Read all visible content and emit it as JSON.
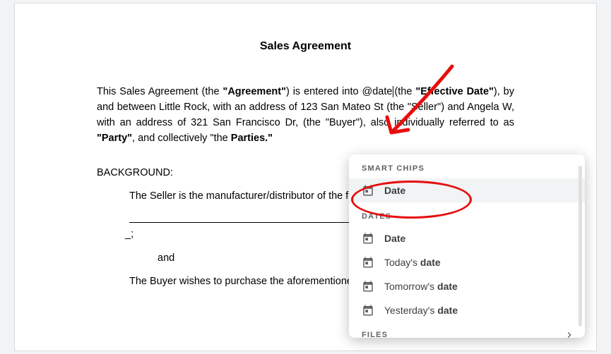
{
  "document": {
    "title": "Sales Agreement",
    "paragraph1_part1": "This Sales Agreement (the ",
    "paragraph1_bold1": "\"Agreement\"",
    "paragraph1_part2": ") is entered into ",
    "at_mention": "@date",
    "paragraph1_part3": "(the ",
    "paragraph1_bold2": "\"Effective Date\"",
    "paragraph1_part4": "), by and between Little Rock, with an address of 123 San Mateo St (the \"Seller\") and Angela W, with an address of 321 San Francisco Dr, (the \"Buyer\"), also individually referred to as ",
    "paragraph1_bold3": "\"Party\"",
    "paragraph1_part5": ", and collectively \"the ",
    "paragraph1_bold4": "Parties.\"",
    "background_heading": "BACKGROUND:",
    "bg_line1": "The Seller is the manufacturer/distributor of the following product(s):",
    "trailing_semi": "_;",
    "and_text": "and",
    "bg_line2": "The Buyer wishes to purchase the aforementioned product(s)."
  },
  "popover": {
    "section_smart_chips": "SMART CHIPS",
    "item_date_chip": "Date",
    "section_dates": "DATES",
    "item_date": {
      "prefix": "",
      "bold": "Date",
      "suffix": ""
    },
    "item_today": {
      "prefix": "Today's ",
      "bold": "date",
      "suffix": ""
    },
    "item_tomorrow": {
      "prefix": "Tomorrow's ",
      "bold": "date",
      "suffix": ""
    },
    "item_yesterday": {
      "prefix": "Yesterday's ",
      "bold": "date",
      "suffix": ""
    },
    "section_files": "FILES"
  }
}
